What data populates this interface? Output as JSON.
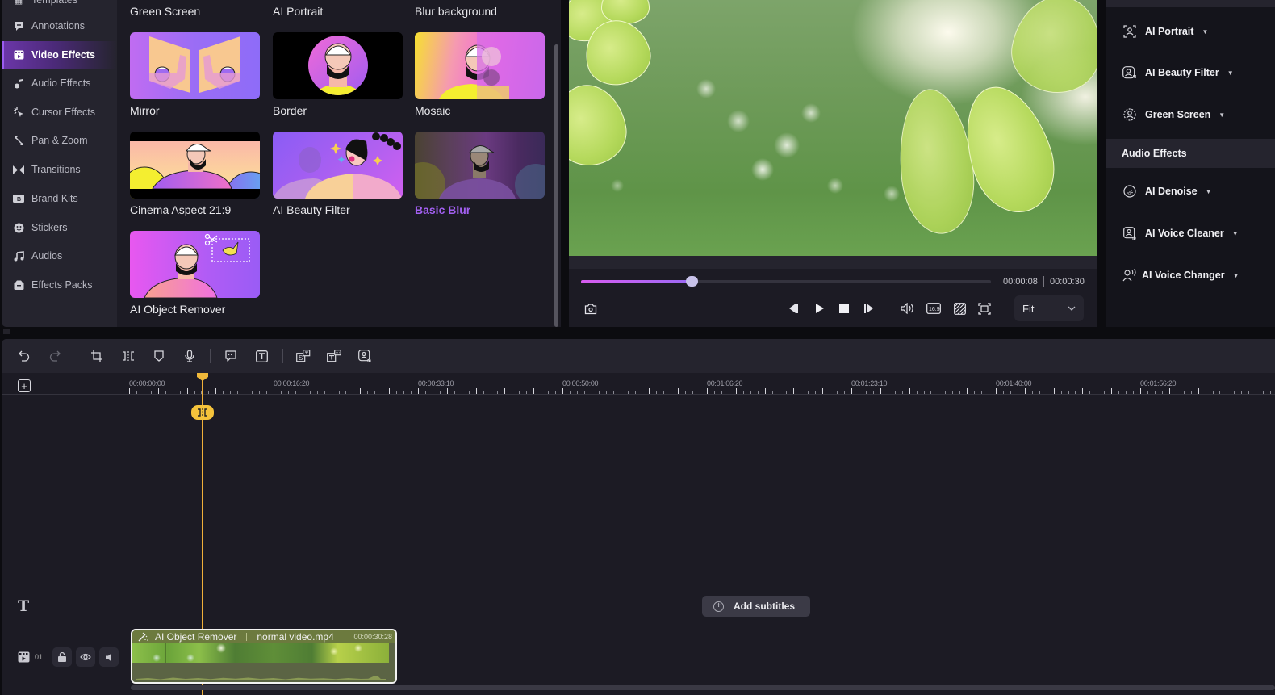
{
  "sidebar": {
    "items": [
      {
        "label": "Templates",
        "icon": "templates-icon",
        "active": false
      },
      {
        "label": "Annotations",
        "icon": "annotation-icon",
        "active": false
      },
      {
        "label": "Video Effects",
        "icon": "video-effects-icon",
        "active": true
      },
      {
        "label": "Audio Effects",
        "icon": "audio-effects-icon",
        "active": false
      },
      {
        "label": "Cursor Effects",
        "icon": "cursor-effects-icon",
        "active": false
      },
      {
        "label": "Pan & Zoom",
        "icon": "pan-zoom-icon",
        "active": false
      },
      {
        "label": "Transitions",
        "icon": "transitions-icon",
        "active": false
      },
      {
        "label": "Brand Kits",
        "icon": "brand-kits-icon",
        "active": false
      },
      {
        "label": "Stickers",
        "icon": "stickers-icon",
        "active": false
      },
      {
        "label": "Audios",
        "icon": "audios-icon",
        "active": false
      },
      {
        "label": "Effects Packs",
        "icon": "effects-packs-icon",
        "active": false
      }
    ]
  },
  "effects": {
    "top_row_labels": [
      "Green Screen",
      "AI Portrait",
      "Blur background"
    ],
    "items": [
      {
        "label": "Mirror",
        "selected": false
      },
      {
        "label": "Border",
        "selected": false
      },
      {
        "label": "Mosaic",
        "selected": false
      },
      {
        "label": "Cinema Aspect 21:9",
        "selected": false
      },
      {
        "label": "AI Beauty Filter",
        "selected": false
      },
      {
        "label": "Basic Blur",
        "selected": true
      },
      {
        "label": "AI Object Remover",
        "selected": false
      }
    ]
  },
  "preview": {
    "current_time": "00:00:08",
    "total_time": "00:00:30",
    "progress_fraction": 0.27,
    "fit_label": "Fit",
    "aspect_label": "16:9"
  },
  "right_panel": {
    "video_items": [
      {
        "label": "AI Portrait",
        "icon": "ai-portrait-icon"
      },
      {
        "label": "AI Beauty Filter",
        "icon": "ai-beauty-filter-icon"
      },
      {
        "label": "Green Screen",
        "icon": "green-screen-icon"
      }
    ],
    "audio_section_title": "Audio Effects",
    "audio_items": [
      {
        "label": "AI Denoise",
        "icon": "ai-denoise-icon"
      },
      {
        "label": "AI Voice Cleaner",
        "icon": "ai-voice-cleaner-icon"
      },
      {
        "label": "AI Voice Changer",
        "icon": "ai-voice-changer-icon"
      }
    ]
  },
  "timeline": {
    "ruler_labels": [
      "00:00:00:00",
      "00:00:16:20",
      "00:00:33:10",
      "00:00:50:00",
      "00:01:06:20",
      "00:01:23:10",
      "00:01:40:00",
      "00:01:56:20"
    ],
    "add_subtitles_label": "Add subtitles",
    "track_number": "01",
    "clip": {
      "effect_label": "AI Object Remover",
      "file_name": "normal video.mp4",
      "duration": "00:00:30:28"
    },
    "accent_color": "#f0b03a"
  },
  "colors": {
    "accent_purple": "#a360f2",
    "playhead": "#f0b03a"
  }
}
